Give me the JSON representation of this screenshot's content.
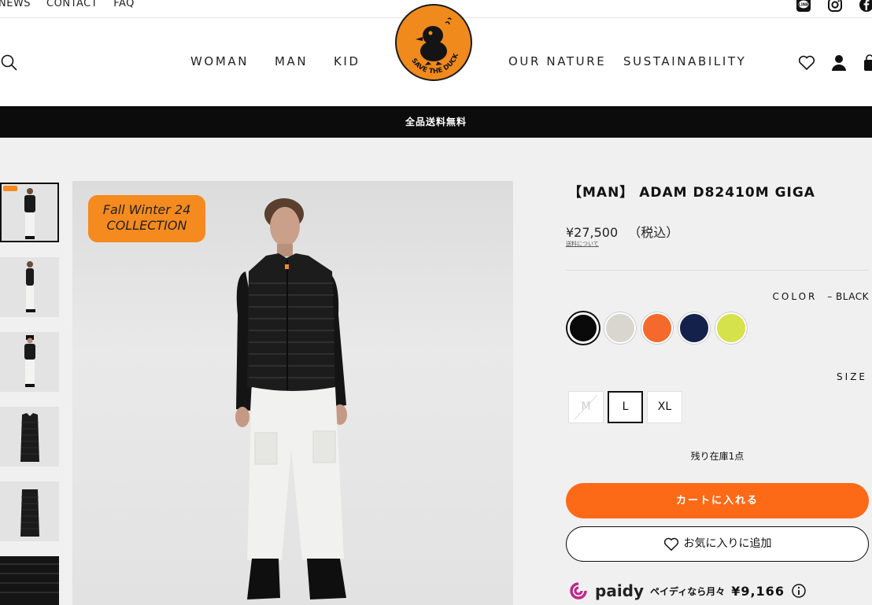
{
  "topbar": {
    "links": [
      "NEWS",
      "CONTACT",
      "FAQ"
    ],
    "social_icons": [
      "line-icon",
      "instagram-icon",
      "facebook-icon"
    ]
  },
  "header": {
    "nav_left": [
      "WOMAN",
      "MAN",
      "KID"
    ],
    "nav_right": [
      "OUR NATURE",
      "SUSTAINABILITY"
    ],
    "logo_text": "SAVE THE DUCK"
  },
  "promo": {
    "text": "全品送料無料"
  },
  "gallery": {
    "badge_line1": "Fall Winter 24",
    "badge_line2": "COLLECTION",
    "thumb_count": 6
  },
  "product": {
    "title": "【MAN】 ADAM D82410M GIGA",
    "price": "¥27,500",
    "tax": "（税込）",
    "shipping_link": "送料について",
    "color_label": "COLOR",
    "color_value": "– BLACK",
    "colors": [
      "#0a0a0a",
      "#d9d6cf",
      "#f56a2c",
      "#14214a",
      "#d6e24a"
    ],
    "size_label": "SIZE",
    "sizes": [
      "M",
      "L",
      "XL"
    ],
    "selected_size": "L",
    "stock_text": "残り在庫1点",
    "cart_button": "カートに入れる",
    "favorite_button": "お気に入りに追加"
  },
  "paidy": {
    "brand": "paidy",
    "text": "ペイディなら月々",
    "amount": "¥9,166"
  }
}
